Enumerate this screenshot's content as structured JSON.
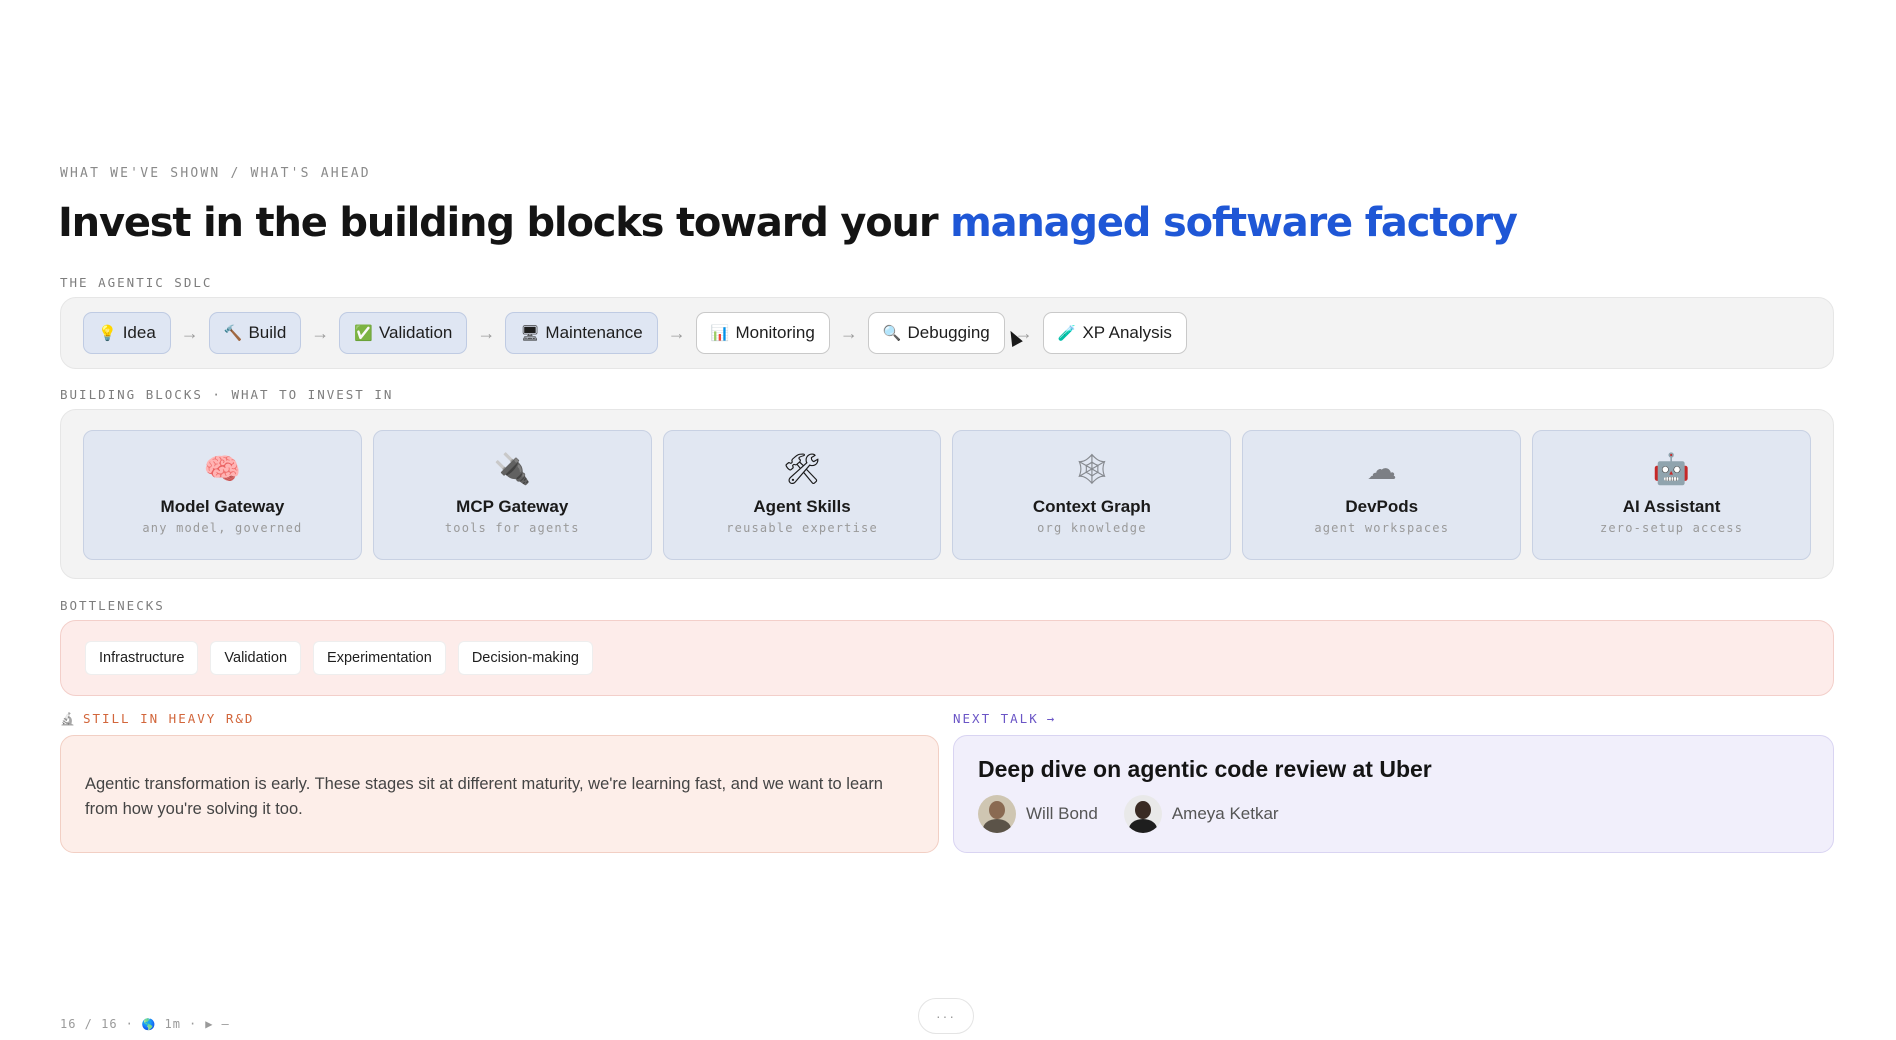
{
  "eyebrow": "WHAT WE'VE SHOWN / WHAT'S AHEAD",
  "headline": {
    "main": "Invest in the building blocks toward your ",
    "accent": "managed software factory"
  },
  "sdlc": {
    "label": "THE AGENTIC SDLC",
    "stages": [
      {
        "icon": "💡",
        "icon_name": "lightbulb-icon",
        "label": "Idea",
        "state": "done"
      },
      {
        "icon": "🔨",
        "icon_name": "hammer-icon",
        "label": "Build",
        "state": "done"
      },
      {
        "icon": "✅",
        "icon_name": "check-icon",
        "label": "Validation",
        "state": "done"
      },
      {
        "icon": "🖥",
        "icon_name": "monitor-icon",
        "label": "Maintenance",
        "state": "done"
      },
      {
        "icon": "📊",
        "icon_name": "bar-chart-icon",
        "label": "Monitoring",
        "state": "future"
      },
      {
        "icon": "🔍",
        "icon_name": "magnifier-icon",
        "label": "Debugging",
        "state": "future"
      },
      {
        "icon": "🧪",
        "icon_name": "test-tube-icon",
        "label": "XP Analysis",
        "state": "future"
      }
    ],
    "arrow": "→"
  },
  "building_blocks": {
    "label": "BUILDING BLOCKS · WHAT TO INVEST IN",
    "items": [
      {
        "icon": "🧠",
        "icon_name": "brain-icon",
        "title": "Model Gateway",
        "subtitle": "any model, governed"
      },
      {
        "icon": "🔌",
        "icon_name": "plug-icon",
        "title": "MCP Gateway",
        "subtitle": "tools for agents"
      },
      {
        "icon": "🛠",
        "icon_name": "tools-icon",
        "title": "Agent Skills",
        "subtitle": "reusable expertise"
      },
      {
        "icon": "🕸",
        "icon_name": "web-icon",
        "title": "Context Graph",
        "subtitle": "org knowledge"
      },
      {
        "icon": "☁",
        "icon_name": "cloud-icon",
        "title": "DevPods",
        "subtitle": "agent workspaces"
      },
      {
        "icon": "🤖",
        "icon_name": "robot-icon",
        "title": "AI Assistant",
        "subtitle": "zero-setup access"
      }
    ]
  },
  "bottlenecks": {
    "label": "BOTTLENECKS",
    "items": [
      "Infrastructure",
      "Validation",
      "Experimentation",
      "Decision-making"
    ]
  },
  "rnd": {
    "label": "STILL IN HEAVY R&D",
    "icon": "🔬",
    "text": "Agentic transformation is early. These stages sit at different maturity, we're learning fast, and we want to learn from how you're solving it too."
  },
  "next_talk": {
    "label": "NEXT TALK",
    "arrow": "→",
    "title": "Deep dive on agentic code review at Uber",
    "speakers": [
      "Will Bond",
      "Ameya Ketkar"
    ]
  },
  "footer": {
    "page": "16 / 16",
    "sep": "·",
    "icon": "🌎",
    "duration": "1m",
    "play": "▶",
    "dash": "–",
    "more": "···"
  }
}
